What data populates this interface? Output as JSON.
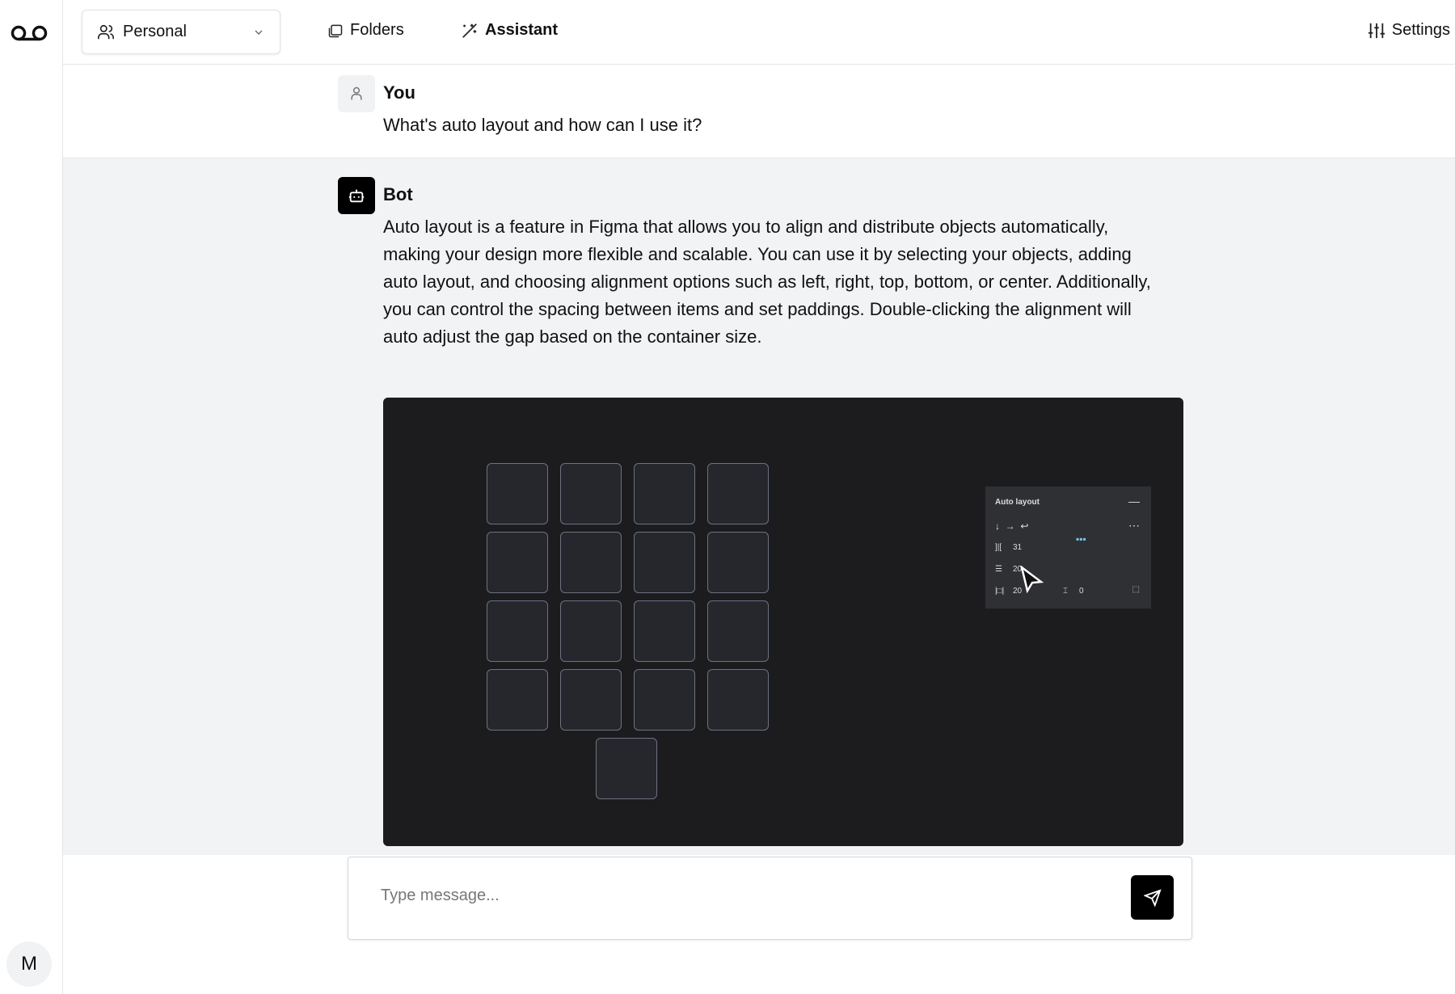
{
  "sidebar": {
    "logo_icon": "voicemail-icon",
    "user_initial": "M"
  },
  "header": {
    "workspace": {
      "label": "Personal",
      "icon": "users-icon"
    },
    "nav": [
      {
        "label": "Folders",
        "icon": "folders-icon"
      },
      {
        "label": "Assistant",
        "icon": "magic-wand-icon",
        "active": true
      }
    ],
    "settings": {
      "label": "Settings",
      "icon": "sliders-icon"
    }
  },
  "chat": {
    "user": {
      "name": "You",
      "message": "What's auto layout and how can I use it?"
    },
    "bot": {
      "name": "Bot",
      "message": "Auto layout is a feature in Figma that allows you to align and distribute objects automatically, making your design more flexible and scalable. You can use it by selecting your objects, adding auto layout, and choosing alignment options such as left, right, top, bottom, or center. Additionally, you can control the spacing between items and set paddings. Double-clicking the alignment will auto adjust the gap based on the container size.",
      "media": {
        "panel_title": "Auto layout",
        "gap": "31",
        "padding_v": "20",
        "padding_h": "20",
        "other": "0"
      }
    }
  },
  "composer": {
    "placeholder": "Type message...",
    "send_icon": "send-icon"
  }
}
